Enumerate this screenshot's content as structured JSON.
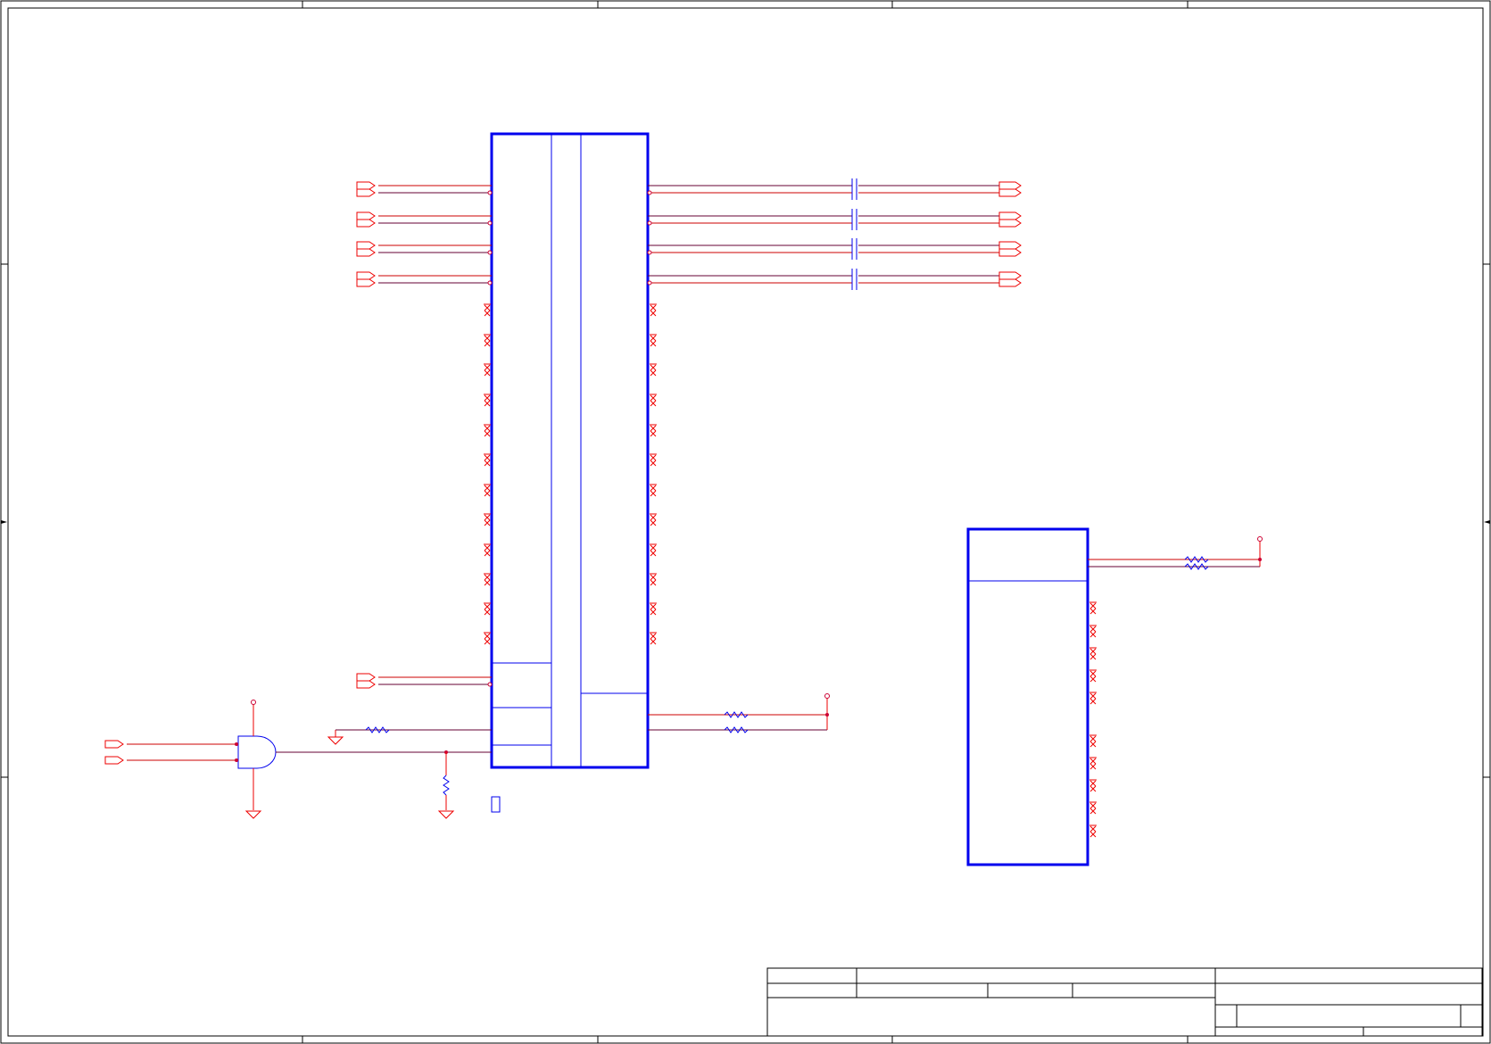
{
  "sheet": {
    "title_block": {}
  }
}
